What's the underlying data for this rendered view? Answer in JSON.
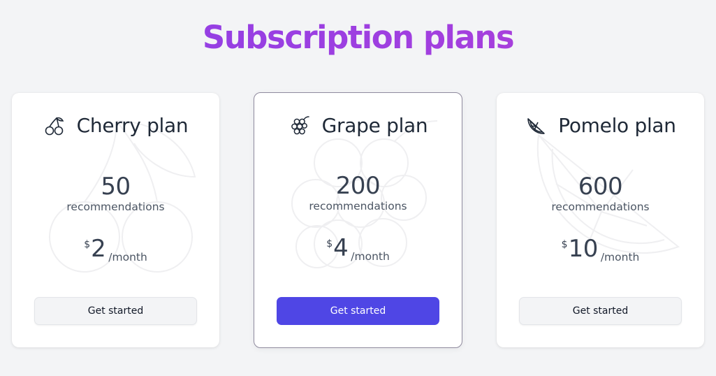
{
  "page": {
    "title": "Subscription plans"
  },
  "plans": [
    {
      "name": "Cherry plan",
      "icon": "cherry-icon",
      "count": "50",
      "count_label": "recommendations",
      "currency": "$",
      "price": "2",
      "period": "/month",
      "button_label": "Get started",
      "featured": false
    },
    {
      "name": "Grape plan",
      "icon": "grape-icon",
      "count": "200",
      "count_label": "recommendations",
      "currency": "$",
      "price": "4",
      "period": "/month",
      "button_label": "Get started",
      "featured": true
    },
    {
      "name": "Pomelo plan",
      "icon": "pomelo-icon",
      "count": "600",
      "count_label": "recommendations",
      "currency": "$",
      "price": "10",
      "period": "/month",
      "button_label": "Get started",
      "featured": false
    }
  ],
  "colors": {
    "title_gradient_start": "#8b3fe6",
    "title_gradient_end": "#b33fd6",
    "primary_button": "#4f46e5",
    "secondary_button": "#f3f4f6",
    "page_background": "#f3f4f6"
  }
}
